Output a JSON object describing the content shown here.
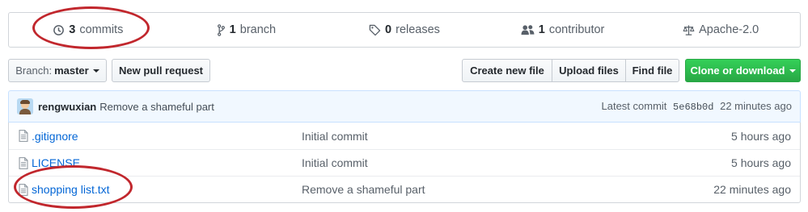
{
  "summary": {
    "commits": {
      "num": "3",
      "label": "commits",
      "icon": "history-icon"
    },
    "branches": {
      "num": "1",
      "label": "branch",
      "icon": "git-branch-icon"
    },
    "releases": {
      "num": "0",
      "label": "releases",
      "icon": "tag-icon"
    },
    "contributors": {
      "num": "1",
      "label": "contributor",
      "icon": "people-icon"
    },
    "license": {
      "label": "Apache-2.0",
      "icon": "law-icon"
    }
  },
  "toolbar": {
    "branch_label": "Branch:",
    "branch_value": "master",
    "new_pull_request": "New pull request",
    "create_new_file": "Create new file",
    "upload_files": "Upload files",
    "find_file": "Find file",
    "clone_or_download": "Clone or download"
  },
  "latest_commit": {
    "author": "rengwuxian",
    "message": "Remove a shameful part",
    "prefix": "Latest commit",
    "sha": "5e68b0d",
    "age": "22 minutes ago"
  },
  "files": [
    {
      "name": ".gitignore",
      "message": "Initial commit",
      "age": "5 hours ago"
    },
    {
      "name": "LICENSE",
      "message": "Initial commit",
      "age": "5 hours ago"
    },
    {
      "name": "shopping list.txt",
      "message": "Remove a shameful part",
      "age": "22 minutes ago"
    }
  ],
  "colors": {
    "link": "#0366d6",
    "clone_button": "#28a745",
    "annotation_circle": "#c1272d"
  }
}
